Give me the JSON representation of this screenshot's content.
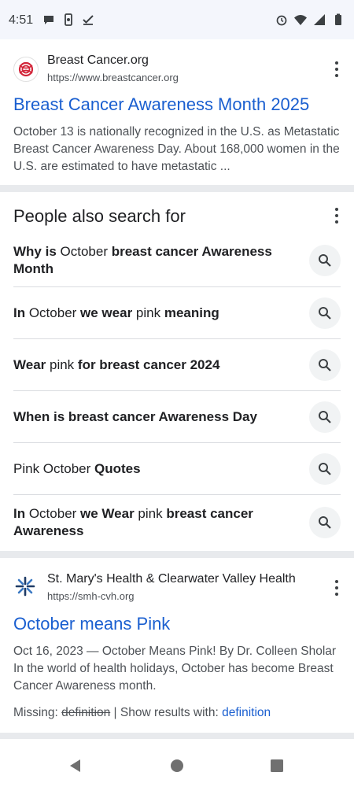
{
  "status": {
    "time": "4:51",
    "left_icons": [
      "chat-bubble-icon",
      "phone-sync-icon",
      "checkmark-icon"
    ],
    "right_icons": [
      "alarm-icon",
      "wifi-icon",
      "signal-icon",
      "battery-icon"
    ]
  },
  "results": [
    {
      "site_name": "Breast Cancer.org",
      "url": "https://www.breastcancer.org",
      "title": "Breast Cancer Awareness Month 2025",
      "snippet": "October 13 is nationally recognized in the U.S. as Metastatic Breast Cancer Awareness Day. About 168,000 women in the U.S. are estimated to have metastatic ..."
    },
    {
      "site_name": "St. Mary's Health & Clearwater Valley Health",
      "url": "https://smh-cvh.org",
      "title": "October means Pink",
      "snippet": "Oct 16, 2023 — October Means Pink! By Dr. Colleen Sholar In the world of health holidays, October has become Breast Cancer Awareness month.",
      "missing_label": "Missing:",
      "missing_term": "definition",
      "show_results_label": "| Show results with:",
      "show_results_term": "definition"
    }
  ],
  "people_also_search": {
    "heading": "People also search for",
    "items": [
      [
        {
          "t": "Why is",
          "b": true
        },
        {
          "t": " October ",
          "b": false
        },
        {
          "t": "breast cancer Awareness Month",
          "b": true
        }
      ],
      [
        {
          "t": "In",
          "b": true
        },
        {
          "t": " October ",
          "b": false
        },
        {
          "t": "we wear",
          "b": true
        },
        {
          "t": " pink ",
          "b": false
        },
        {
          "t": "meaning",
          "b": true
        }
      ],
      [
        {
          "t": "Wear",
          "b": true
        },
        {
          "t": " pink ",
          "b": false
        },
        {
          "t": "for breast cancer 2024",
          "b": true
        }
      ],
      [
        {
          "t": "When is breast cancer Awareness Day",
          "b": true
        }
      ],
      [
        {
          "t": "Pink October ",
          "b": false
        },
        {
          "t": "Quotes",
          "b": true
        }
      ],
      [
        {
          "t": "In",
          "b": true
        },
        {
          "t": " October ",
          "b": false
        },
        {
          "t": "we Wear",
          "b": true
        },
        {
          "t": " pink ",
          "b": false
        },
        {
          "t": "breast cancer Awareness",
          "b": true
        }
      ]
    ]
  },
  "nav": [
    "back-icon",
    "home-icon",
    "recents-icon"
  ]
}
